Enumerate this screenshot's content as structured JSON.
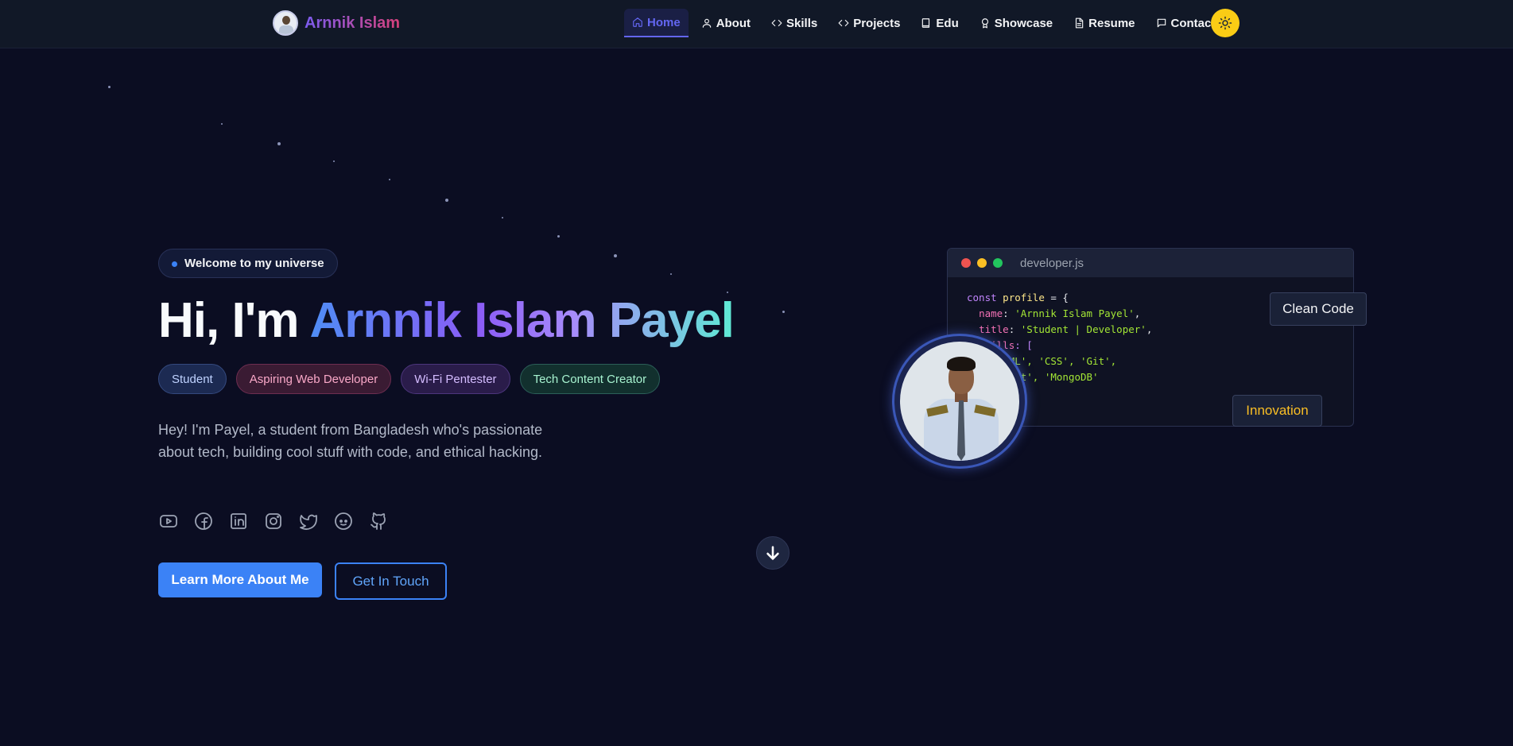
{
  "brand": {
    "name": "Arnnik Islam"
  },
  "nav": {
    "items": [
      {
        "label": "Home",
        "icon": "home-icon",
        "active": true
      },
      {
        "label": "About",
        "icon": "user-icon"
      },
      {
        "label": "Skills",
        "icon": "code-icon"
      },
      {
        "label": "Projects",
        "icon": "code-icon"
      },
      {
        "label": "Edu",
        "icon": "book-icon"
      },
      {
        "label": "Showcase",
        "icon": "award-icon"
      },
      {
        "label": "Resume",
        "icon": "file-icon"
      },
      {
        "label": "Contact",
        "icon": "message-icon"
      }
    ],
    "theme_icon": "sun-icon"
  },
  "hero": {
    "welcome": "Welcome to my universe",
    "title_prefix": "Hi, I'm ",
    "title_name": "Arnnik Islam Payel",
    "tags": [
      "Student",
      "Aspiring Web Developer",
      "Wi-Fi Pentester",
      "Tech Content Creator"
    ],
    "bio": "Hey! I'm Payel, a student from Bangladesh who's passionate about tech, building cool stuff with code, and ethical hacking.",
    "socials": [
      "youtube-icon",
      "facebook-icon",
      "linkedin-icon",
      "instagram-icon",
      "twitter-icon",
      "reddit-icon",
      "github-icon"
    ],
    "primary_button": "Learn More About Me",
    "secondary_button": "Get In Touch"
  },
  "code_card": {
    "filename": "developer.js",
    "lines": {
      "l1_kw": "const",
      "l1_var": "profile",
      "l1_rest": " = {",
      "l2_prop": "name",
      "l2_val": "'Arnnik Islam Payel'",
      "l3_prop": "title",
      "l3_val": "'Student | Developer'",
      "l4_prop": "skills",
      "l4_rest": ": [",
      "l5": "'HTML', 'CSS', 'Git',",
      "l6": "'React', 'MongoDB'"
    },
    "badge_clean": "Clean Code",
    "badge_innovation": "Innovation"
  },
  "colors": {
    "background": "#0b0d22",
    "accent": "#3b82f6",
    "nav_active": "#6366f1",
    "theme_toggle": "#facc15"
  }
}
